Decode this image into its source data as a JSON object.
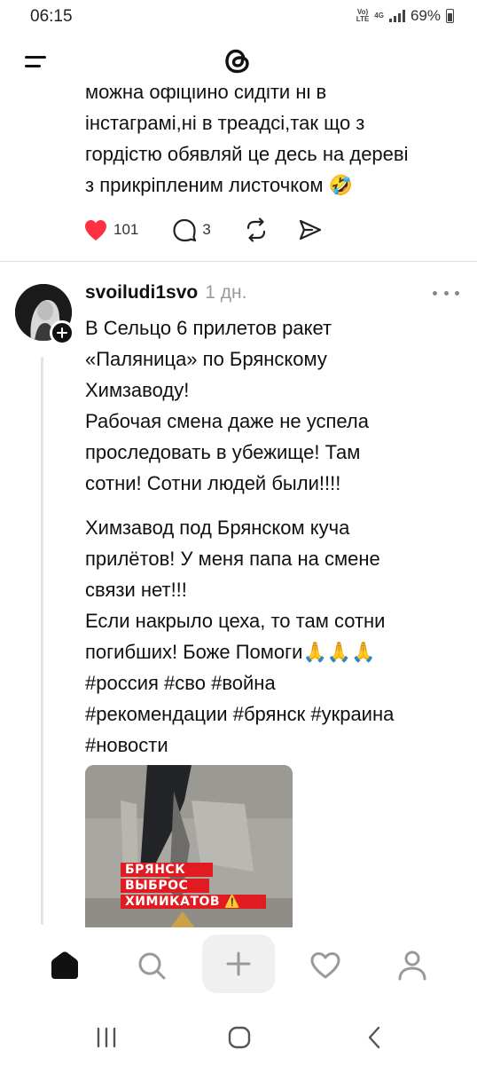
{
  "status_bar": {
    "time": "06:15",
    "volte": "Vo)\nLTE",
    "network": "4G",
    "battery": "69%"
  },
  "header": {
    "logo_icon": "threads-logo-icon",
    "menu_icon": "hamburger-menu-icon"
  },
  "previous_post": {
    "lines": [
      "можна офіціино сидіти ні в",
      "інстаграмі,ні в треадсі,так що з",
      "гордістю обявляй це десь на дереві",
      "з прикріпленим листочком 🤣"
    ],
    "likes": "101",
    "replies": "3"
  },
  "post": {
    "username": "svoiludi1svo",
    "time": "1 дн.",
    "paragraph1": [
      "В Сельцо 6 прилетов ракет",
      "«Паляница» по Брянскому",
      "Химзаводу!",
      "Рабочая смена даже не успела",
      "проследовать в убежище! Там",
      "сотни! Сотни людей были!!!!"
    ],
    "paragraph2": [
      "Химзавод под Брянском куча",
      "прилётов! У меня папа на смене",
      "связи нет!!!",
      "Если накрыло цеха, то там сотни",
      "погибших! Боже Помоги🙏🙏🙏"
    ],
    "hashtags": {
      "h1": "#россия",
      "h2": "#сво",
      "h3": "#война",
      "h4": "#рекомендации",
      "h5": "#брянск",
      "h6": "#украина",
      "h7": "#новости"
    },
    "media": {
      "banner_line1": "БРЯНСК",
      "banner_line2": "ВЫБРОС",
      "banner_line3": "ХИМИКАТОВ ⚠️"
    }
  },
  "colors": {
    "like_red": "#ff3040",
    "banner_red": "#e01b22",
    "muted_gray": "#9a9a9a"
  }
}
